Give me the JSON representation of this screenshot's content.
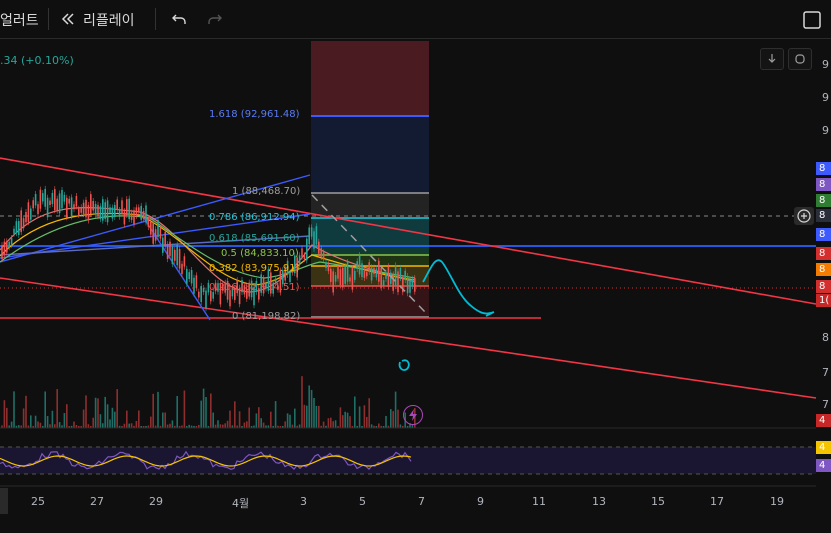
{
  "toolbar": {
    "alert_label": "얼러트",
    "replay_label": "리플레이"
  },
  "legend": {
    "change_text": ".34 (+0.10%)"
  },
  "fib_levels": [
    {
      "label": "1.618 (92,961.48)",
      "color": "#5b7cf6"
    },
    {
      "label": "1 (88,468.70)",
      "color": "#9e9e9e"
    },
    {
      "label": "0.786 (86,912.94)",
      "color": "#26c6da"
    },
    {
      "label": "0.618 (85,691.60)",
      "color": "#26a69a"
    },
    {
      "label": "0.5 (84,833.10)",
      "color": "#8bc34a"
    },
    {
      "label": "0.382 (83,975.91)",
      "color": "#f5b800"
    },
    {
      "label": "0.236 (82,914.51)",
      "color": "#ef5350"
    },
    {
      "label": "0 (81,198.82)",
      "color": "#9e9e9e"
    }
  ],
  "price_axis": {
    "ticks": [
      "9",
      "9",
      "9",
      "8",
      "7",
      "7"
    ],
    "tags": [
      {
        "text": "8",
        "color": "#3d5afe"
      },
      {
        "text": "8",
        "color": "#7e57c2"
      },
      {
        "text": "8",
        "color": "#2e7d32"
      },
      {
        "text": "8",
        "color": "#2a2e39"
      },
      {
        "text": "8",
        "color": "#3d5afe"
      },
      {
        "text": "8",
        "color": "#d32f2f"
      },
      {
        "text": "8",
        "color": "#f57c00"
      },
      {
        "text": "8",
        "color": "#d32f2f"
      },
      {
        "text": "1(",
        "color": "#c62828"
      },
      {
        "text": "4",
        "color": "#c62828"
      }
    ],
    "rsi_tags": [
      {
        "text": "4",
        "color": "#f5c400"
      },
      {
        "text": "4",
        "color": "#7e57c2"
      }
    ]
  },
  "time_axis": {
    "labels": [
      "25",
      "27",
      "29",
      "4월",
      "3",
      "5",
      "7",
      "9",
      "11",
      "13",
      "15",
      "17",
      "19"
    ]
  },
  "colors": {
    "background": "#0f0f0f",
    "trendline": "#f23645",
    "blue_line": "#2962ff",
    "cyan_path": "#00bcd4",
    "rsi_line": "#7e57c2",
    "rsi_ma": "#f5c400"
  },
  "icons": {
    "replay": "rewind-icon",
    "undo": "undo-icon",
    "redo": "redo-icon",
    "fullscreen": "fullscreen-icon",
    "download": "download-icon",
    "lightning": "lightning-icon",
    "crosshair_add": "add-circle-icon"
  }
}
